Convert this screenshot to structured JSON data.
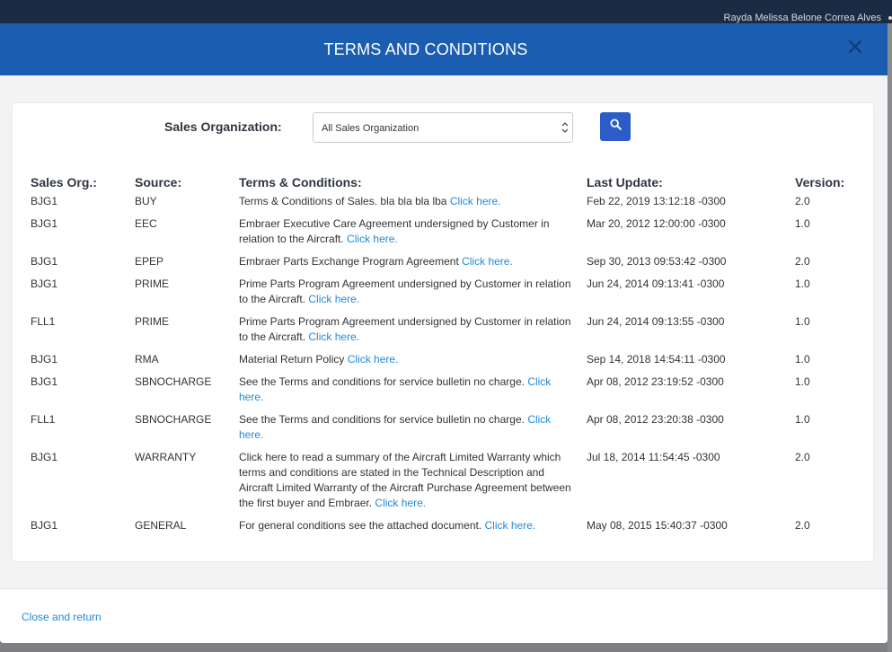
{
  "background": {
    "user_name": "Rayda Melissa Belone Correa Alves"
  },
  "modal": {
    "title": "TERMS AND CONDITIONS",
    "close_icon": "close-icon",
    "filter": {
      "label": "Sales Organization:",
      "selected": "All Sales Organization",
      "search_icon": "search-icon"
    },
    "columns": [
      "Sales Org.:",
      "Source:",
      "Terms & Conditions:",
      "Last Update:",
      "Version:"
    ],
    "rows": [
      {
        "org": "BJG1",
        "source": "BUY",
        "terms": "Terms & Conditions of Sales. bla bla bla lba",
        "link": "Click here.",
        "updated": "Feb 22, 2019 13:12:18 -0300",
        "version": "2.0"
      },
      {
        "org": "BJG1",
        "source": "EEC",
        "terms": "Embraer Executive Care Agreement undersigned by Customer in relation to the Aircraft.",
        "link": "Click here.",
        "updated": "Mar 20, 2012 12:00:00 -0300",
        "version": "1.0"
      },
      {
        "org": "BJG1",
        "source": "EPEP",
        "terms": "Embraer Parts Exchange Program Agreement",
        "link": "Click here.",
        "updated": "Sep 30, 2013 09:53:42 -0300",
        "version": "2.0"
      },
      {
        "org": "BJG1",
        "source": "PRIME",
        "terms": "Prime Parts Program Agreement undersigned by Customer in relation to the Aircraft.",
        "link": "Click here.",
        "updated": "Jun 24, 2014 09:13:41 -0300",
        "version": "1.0"
      },
      {
        "org": "FLL1",
        "source": "PRIME",
        "terms": "Prime Parts Program Agreement undersigned by Customer in relation to the Aircraft.",
        "link": "Click here.",
        "updated": "Jun 24, 2014 09:13:55 -0300",
        "version": "1.0"
      },
      {
        "org": "BJG1",
        "source": "RMA",
        "terms": "Material Return Policy",
        "link": "Click here.",
        "updated": "Sep 14, 2018 14:54:11 -0300",
        "version": "1.0"
      },
      {
        "org": "BJG1",
        "source": "SBNOCHARGE",
        "terms": "See the Terms and conditions for service bulletin no charge.",
        "link": "Click here.",
        "updated": "Apr 08, 2012 23:19:52 -0300",
        "version": "1.0"
      },
      {
        "org": "FLL1",
        "source": "SBNOCHARGE",
        "terms": "See the Terms and conditions for service bulletin no charge.",
        "link": "Click here.",
        "updated": "Apr 08, 2012 23:20:38 -0300",
        "version": "1.0"
      },
      {
        "org": "BJG1",
        "source": "WARRANTY",
        "terms": "Click here to read a summary of the Aircraft Limited Warranty which terms and conditions are stated in the Technical Description and Aircraft Limited Warranty of the Aircraft Purchase Agreement between the first buyer and Embraer.",
        "link": "Click here.",
        "updated": "Jul 18, 2014 11:54:45 -0300",
        "version": "2.0"
      },
      {
        "org": "BJG1",
        "source": "GENERAL",
        "terms": "For general conditions see the attached document.",
        "link": "Click here.",
        "updated": "May 08, 2015 15:40:37 -0300",
        "version": "2.0"
      }
    ],
    "footer": {
      "close_label": "Close and return"
    }
  },
  "colors": {
    "header_blue": "#1b5db0",
    "search_button": "#2b5cc7",
    "link": "#1f8ad8",
    "topbar": "#1b2b44"
  }
}
